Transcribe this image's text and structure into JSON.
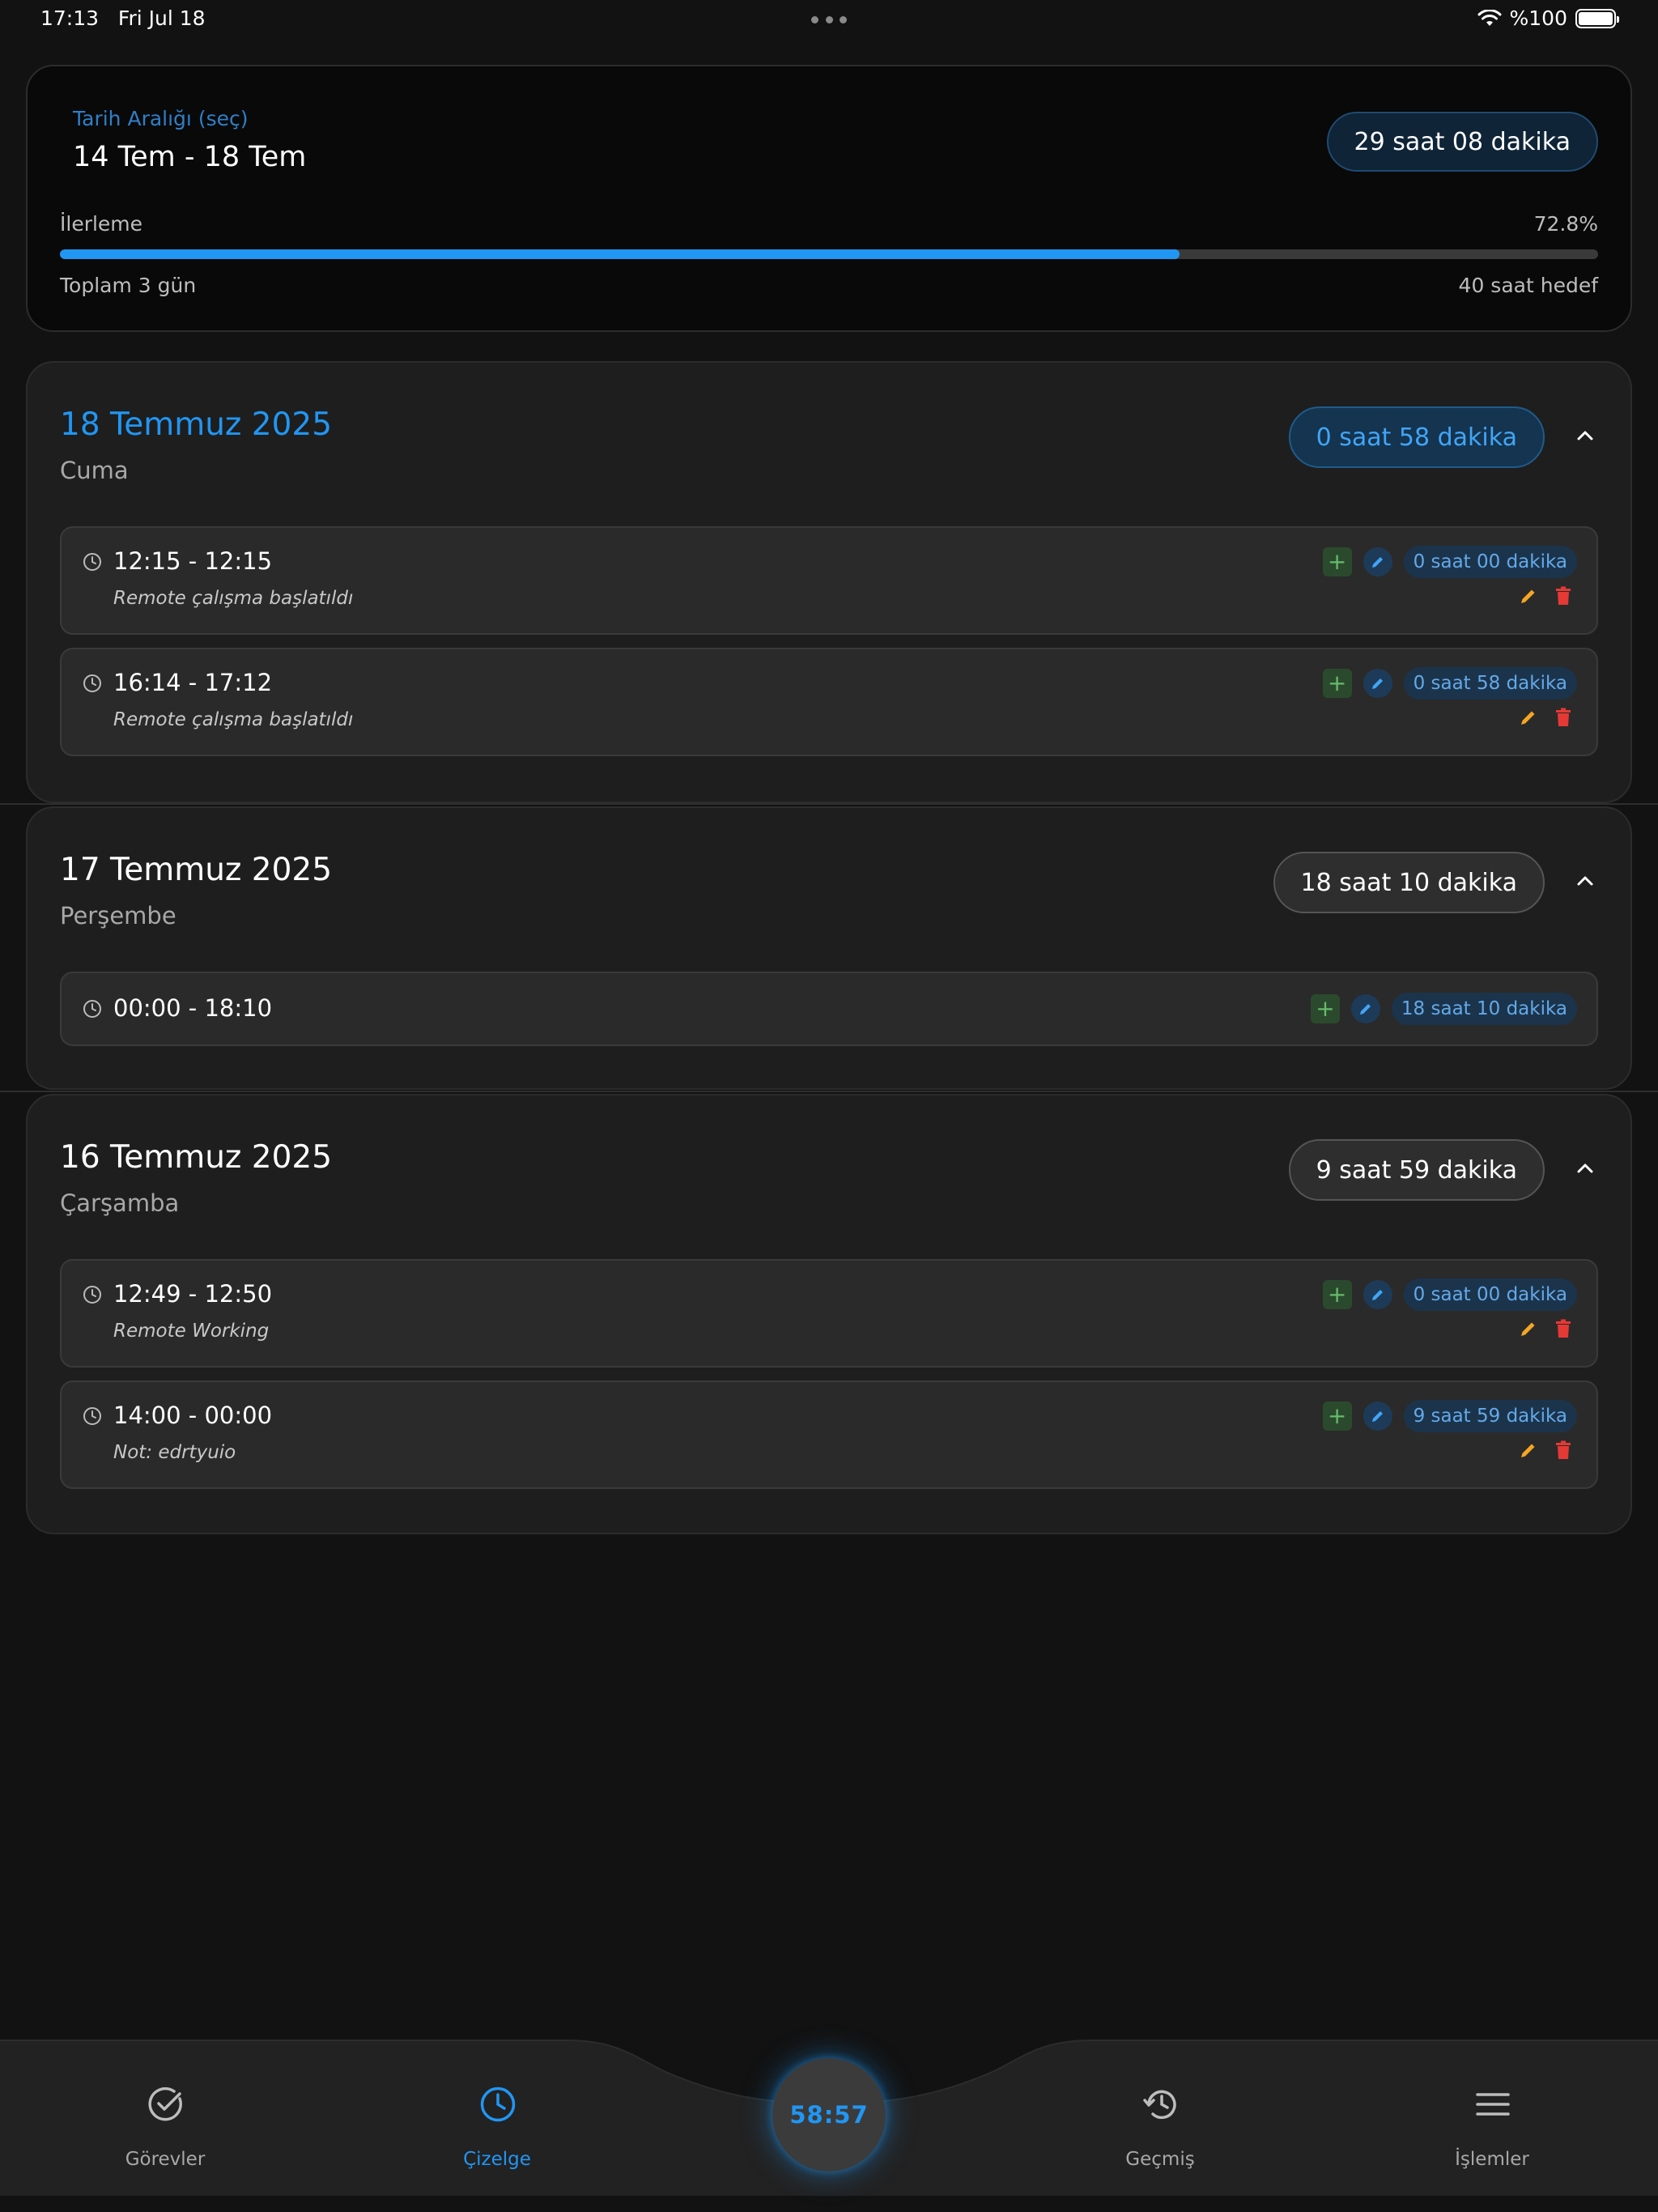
{
  "status_bar": {
    "time": "17:13",
    "date": "Fri Jul 18",
    "battery": "%100"
  },
  "summary": {
    "range_label": "Tarih Aralığı (seç)",
    "range_value": "14 Tem - 18 Tem",
    "total": "29 saat 08 dakika",
    "progress_label": "İlerleme",
    "progress_percent": "72.8%",
    "progress_fraction": 0.728,
    "days_total": "Toplam 3 gün",
    "target": "40 saat hedef"
  },
  "days": [
    {
      "title": "18 Temmuz 2025",
      "weekday": "Cuma",
      "total": "0 saat 58 dakika",
      "entries": [
        {
          "time": "12:15 - 12:15",
          "note": "Remote çalışma başlatıldı",
          "duration": "0 saat 00 dakika"
        },
        {
          "time": "16:14 - 17:12",
          "note": "Remote çalışma başlatıldı",
          "duration": "0 saat 58 dakika"
        }
      ]
    },
    {
      "title": "17 Temmuz 2025",
      "weekday": "Perşembe",
      "total": "18 saat 10 dakika",
      "entries": [
        {
          "time": "00:00 - 18:10",
          "duration": "18 saat 10 dakika"
        }
      ]
    },
    {
      "title": "16 Temmuz 2025",
      "weekday": "Çarşamba",
      "total": "9 saat 59 dakika",
      "entries": [
        {
          "time": "12:49 - 12:50",
          "note": "Remote Working",
          "duration": "0 saat 00 dakika"
        },
        {
          "time": "14:00 - 00:00",
          "note": "Not: edrtyuio",
          "duration": "9 saat 59 dakika"
        }
      ]
    }
  ],
  "timer": "58:57",
  "nav": {
    "tasks": "Görevler",
    "schedule": "Çizelge",
    "history": "Geçmiş",
    "operations": "İşlemler"
  },
  "colors": {
    "accent": "#2196f3",
    "background": "#121212",
    "card": "#1e1e1e",
    "add_green": "#66bb6a",
    "edit_orange": "#f5a623",
    "delete_red": "#e53935"
  }
}
